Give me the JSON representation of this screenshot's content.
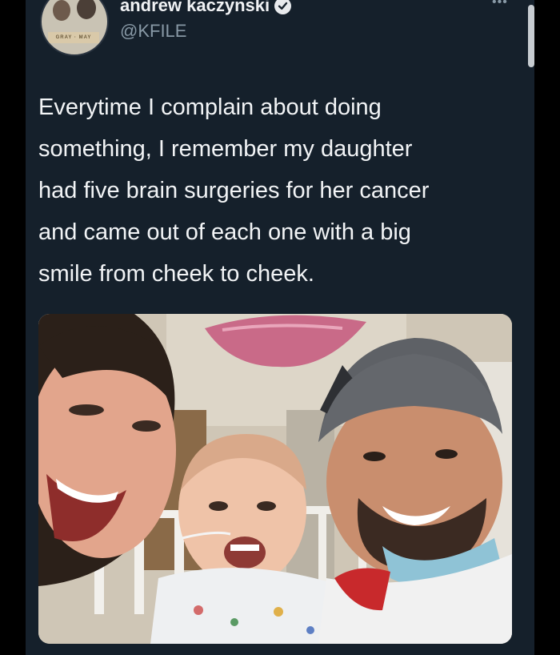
{
  "tweet": {
    "author": {
      "display_name": "andrew kaczynski",
      "handle": "@KFILE",
      "verified": true,
      "avatar_caption": "GRAY · MAY"
    },
    "more_icon": "more-horizontal-icon",
    "text": "Everytime I complain about doing something, I remember my daughter had five brain surgeries for her cancer and came out of each one with a big smile from cheek to cheek.",
    "text_lines": [
      "Everytime I complain about doing",
      "something, I remember my daughter",
      "had five brain surgeries for her cancer",
      "and came out of each one with a big",
      "smile from cheek to cheek."
    ]
  },
  "colors": {
    "background": "#15202b",
    "page_border": "#000000",
    "text": "#f2f4f6",
    "secondary_text": "#8899a6"
  }
}
